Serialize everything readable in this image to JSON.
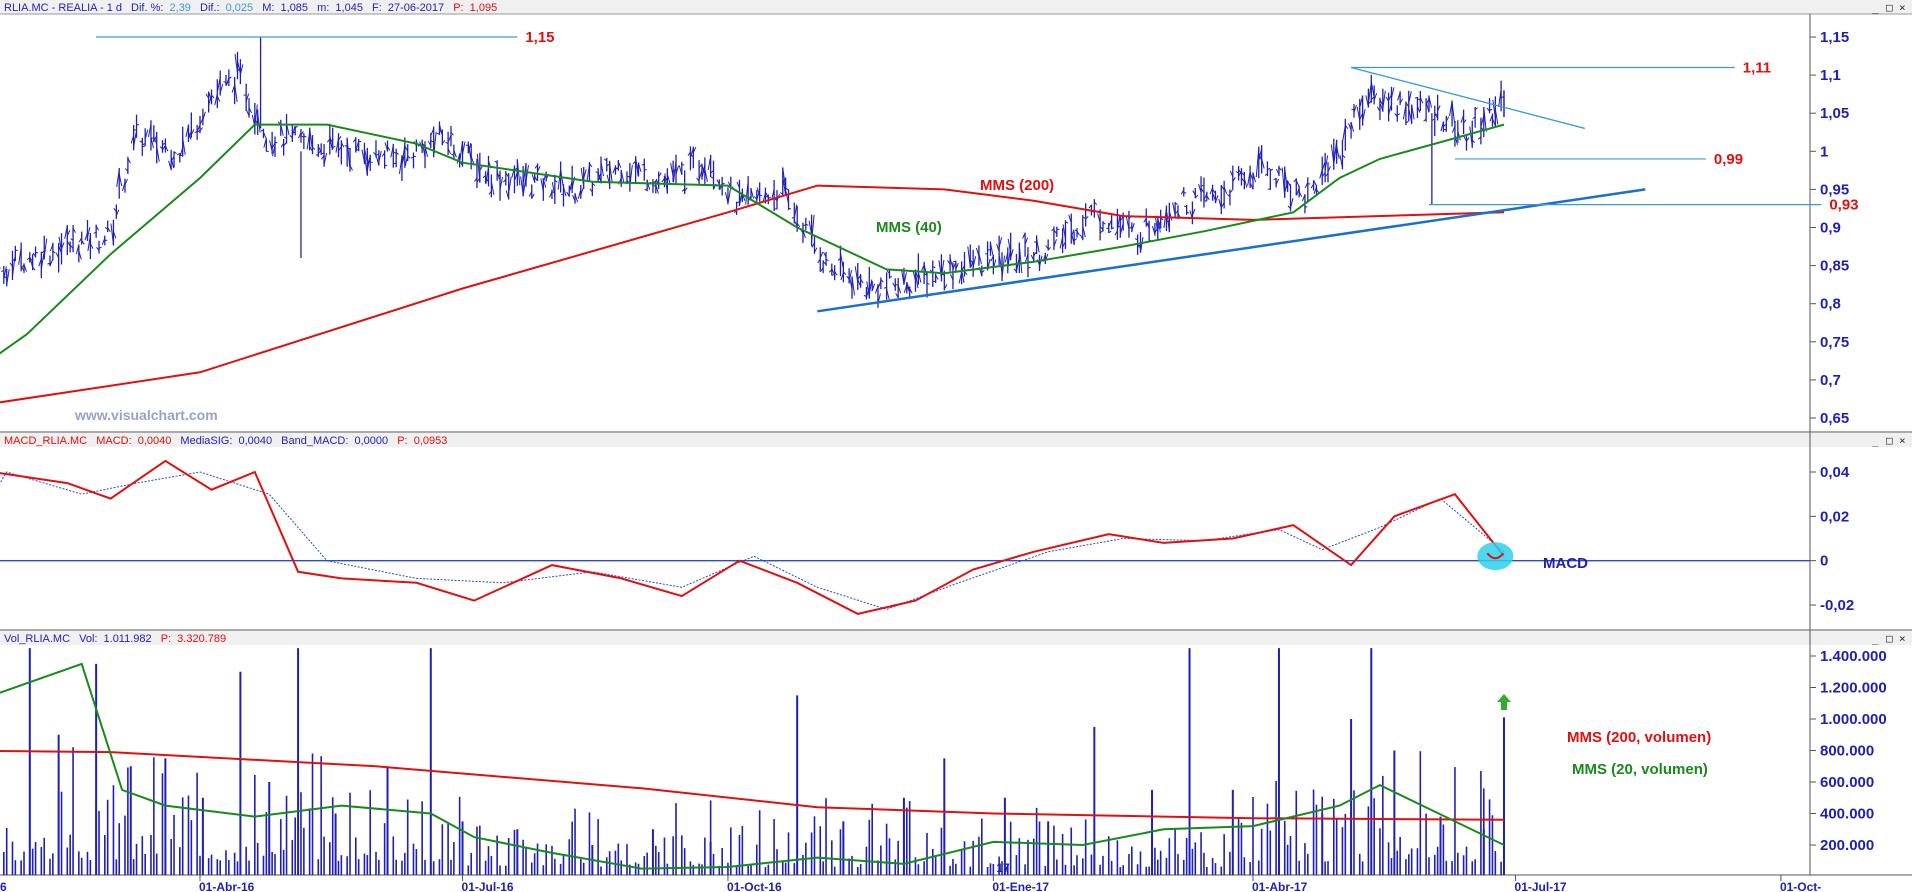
{
  "colors": {
    "price": "#1f1fb8",
    "mms200": "#e01010",
    "mms40": "#1a8a1a",
    "trend": "#1a6fd0",
    "level": "#3a9ad9",
    "macd": "#e01010",
    "signal": "#2a4ad0",
    "highlight": "#2fd0ea",
    "arrow": "#33aa33"
  },
  "window_controls": {
    "minimize": "_",
    "maximize": "□",
    "close": "×"
  },
  "price_panel": {
    "header": {
      "symbol": "RLIA.MC - REALIA - 1 d",
      "difpct_label": "Dif. %:",
      "difpct_value": "2,39",
      "dif_label": "Dif.:",
      "dif_value": "0,025",
      "m_label": "M:",
      "m_value": "1,085",
      "min_label": "m:",
      "min_value": "1,045",
      "date_label": "F:",
      "date_value": "27-06-2017",
      "p_label": "P:",
      "p_value": "1,095"
    },
    "watermark": "www.visualchart.com",
    "y_ticks": [
      "1,15",
      "1,1",
      "1,05",
      "1",
      "0,95",
      "0,9",
      "0,85",
      "0,8",
      "0,75",
      "0,7",
      "0,65"
    ],
    "labels": {
      "high1": "1,15",
      "high2": "1,11",
      "support1": "0,99",
      "support2": "0,93",
      "mms200": "MMS (200)",
      "mms40": "MMS (40)"
    }
  },
  "macd_panel": {
    "header": {
      "name": "MACD_RLIA.MC",
      "macd_label": "MACD:",
      "macd_value": "0,0040",
      "sig_label": "MediaSIG:",
      "sig_value": "0,0040",
      "band_label": "Band_MACD:",
      "band_value": "0,0000",
      "p_label": "P:",
      "p_value": "0,0953"
    },
    "y_ticks": [
      "0,04",
      "0,02",
      "0",
      "-0,02"
    ],
    "label": "MACD"
  },
  "volume_panel": {
    "header": {
      "name": "Vol_RLIA.MC",
      "vol_label": "Vol:",
      "vol_value": "1.011.982",
      "p_label": "P:",
      "p_value": "3.320.789"
    },
    "y_ticks": [
      "1.400.000",
      "1.200.000",
      "1.000.000",
      "800.000",
      "600.000",
      "400.000",
      "200.000"
    ],
    "label_mms200": "MMS (200, volumen)",
    "label_mms20": "MMS (20, volumen)"
  },
  "x_axis": {
    "ticks": [
      "01-Abr-16",
      "01-Jul-16",
      "01-Oct-16",
      "01-Ene-17",
      "01-Abr-17",
      "01-Jul-17",
      "01-Oct-"
    ],
    "left_edge": "6",
    "under_cursor": "17"
  },
  "chart_data": [
    {
      "type": "line",
      "panel": "price",
      "ylim": [
        0.64,
        1.17
      ],
      "x_start": "2016-01-04",
      "last_date": "2017-06-27",
      "high_levels": [
        1.15,
        1.11
      ],
      "support_levels": [
        0.99,
        0.93
      ],
      "series": [
        {
          "name": "MMS (200)",
          "x": [
            "2016-01-04",
            "2016-04-01",
            "2016-07-01",
            "2016-10-01",
            "2016-11-01",
            "2016-12-15",
            "2017-01-15",
            "2017-02-15",
            "2017-04-01",
            "2017-06-27"
          ],
          "values": [
            0.66,
            0.71,
            0.82,
            0.92,
            0.955,
            0.95,
            0.935,
            0.915,
            0.91,
            0.92
          ]
        },
        {
          "name": "MMS (40)",
          "x": [
            "2016-01-04",
            "2016-02-01",
            "2016-03-01",
            "2016-04-01",
            "2016-04-20",
            "2016-05-15",
            "2016-06-15",
            "2016-07-01",
            "2016-08-15",
            "2016-10-01",
            "2016-10-25",
            "2016-11-25",
            "2016-12-15",
            "2017-01-15",
            "2017-02-15",
            "2017-03-15",
            "2017-04-15",
            "2017-05-01",
            "2017-05-15",
            "2017-06-27"
          ],
          "values": [
            0.685,
            0.76,
            0.865,
            0.965,
            1.035,
            1.035,
            1.01,
            0.985,
            0.96,
            0.955,
            0.9,
            0.845,
            0.84,
            0.855,
            0.875,
            0.895,
            0.92,
            0.965,
            0.99,
            1.035
          ]
        },
        {
          "name": "Precio",
          "x": [
            "2016-01-04",
            "2016-01-15",
            "2016-02-01",
            "2016-02-20",
            "2016-03-01",
            "2016-03-10",
            "2016-03-25",
            "2016-04-05",
            "2016-04-15",
            "2016-04-25",
            "2016-05-10",
            "2016-05-25",
            "2016-06-10",
            "2016-06-25",
            "2016-07-10",
            "2016-07-25",
            "2016-08-10",
            "2016-08-25",
            "2016-09-10",
            "2016-09-25",
            "2016-10-05",
            "2016-10-20",
            "2016-11-05",
            "2016-11-20",
            "2016-12-05",
            "2016-12-20",
            "2017-01-05",
            "2017-01-20",
            "2017-02-05",
            "2017-02-20",
            "2017-03-05",
            "2017-03-20",
            "2017-04-05",
            "2017-04-20",
            "2017-05-01",
            "2017-05-10",
            "2017-05-25",
            "2017-06-05",
            "2017-06-15",
            "2017-06-27"
          ],
          "values": [
            0.67,
            0.83,
            0.86,
            0.88,
            0.89,
            1.02,
            1.0,
            1.07,
            1.1,
            1.02,
            1.01,
            1.0,
            0.99,
            1.02,
            0.97,
            0.96,
            0.95,
            0.98,
            0.96,
            0.99,
            0.93,
            0.95,
            0.85,
            0.82,
            0.83,
            0.85,
            0.86,
            0.87,
            0.92,
            0.89,
            0.93,
            0.94,
            0.98,
            0.94,
            1.0,
            1.07,
            1.06,
            1.05,
            1.02,
            1.07
          ]
        }
      ]
    },
    {
      "type": "line",
      "panel": "macd",
      "ylim": [
        -0.03,
        0.05
      ],
      "series": [
        {
          "name": "MACD",
          "x": [
            "2016-01-04",
            "2016-01-20",
            "2016-02-15",
            "2016-03-01",
            "2016-03-20",
            "2016-04-05",
            "2016-04-20",
            "2016-05-05",
            "2016-05-20",
            "2016-06-15",
            "2016-07-05",
            "2016-08-01",
            "2016-08-25",
            "2016-09-15",
            "2016-10-05",
            "2016-10-25",
            "2016-11-15",
            "2016-12-05",
            "2016-12-25",
            "2017-01-15",
            "2017-02-10",
            "2017-03-01",
            "2017-03-25",
            "2017-04-15",
            "2017-05-05",
            "2017-05-20",
            "2017-06-10",
            "2017-06-27"
          ],
          "values": [
            -0.005,
            0.04,
            0.035,
            0.028,
            0.045,
            0.032,
            0.04,
            -0.005,
            -0.008,
            -0.01,
            -0.018,
            -0.002,
            -0.008,
            -0.016,
            0.0,
            -0.01,
            -0.024,
            -0.018,
            -0.004,
            0.004,
            0.012,
            0.008,
            0.01,
            0.016,
            -0.002,
            0.02,
            0.03,
            0.002
          ]
        },
        {
          "name": "MediaSIG",
          "x": [
            "2016-01-04",
            "2016-01-25",
            "2016-02-20",
            "2016-03-10",
            "2016-04-01",
            "2016-04-25",
            "2016-05-15",
            "2016-06-15",
            "2016-07-15",
            "2016-08-15",
            "2016-09-15",
            "2016-10-10",
            "2016-11-01",
            "2016-11-25",
            "2016-12-20",
            "2017-01-20",
            "2017-02-15",
            "2017-03-15",
            "2017-04-10",
            "2017-04-25",
            "2017-05-15",
            "2017-06-05",
            "2017-06-27"
          ],
          "values": [
            -0.005,
            0.04,
            0.03,
            0.035,
            0.04,
            0.03,
            0.0,
            -0.008,
            -0.01,
            -0.005,
            -0.012,
            0.002,
            -0.012,
            -0.022,
            -0.01,
            0.004,
            0.01,
            0.009,
            0.014,
            0.005,
            0.015,
            0.028,
            0.004
          ]
        }
      ]
    },
    {
      "type": "bar",
      "panel": "volume",
      "ylim": [
        0,
        1500000
      ],
      "bars": [
        {
          "x": "2016-01-10",
          "value": 1400000
        },
        {
          "x": "2016-01-20",
          "value": 1450000
        },
        {
          "x": "2016-02-02",
          "value": 1450000
        },
        {
          "x": "2016-02-12",
          "value": 900000
        },
        {
          "x": "2016-02-25",
          "value": 1350000
        },
        {
          "x": "2016-03-08",
          "value": 700000
        },
        {
          "x": "2016-03-20",
          "value": 750000
        },
        {
          "x": "2016-04-02",
          "value": 500000
        },
        {
          "x": "2016-04-15",
          "value": 1300000
        },
        {
          "x": "2016-04-25",
          "value": 600000
        },
        {
          "x": "2016-05-05",
          "value": 1450000
        },
        {
          "x": "2016-05-18",
          "value": 400000
        },
        {
          "x": "2016-06-05",
          "value": 700000
        },
        {
          "x": "2016-06-20",
          "value": 1450000
        },
        {
          "x": "2016-07-01",
          "value": 350000
        },
        {
          "x": "2016-07-20",
          "value": 300000
        },
        {
          "x": "2016-08-15",
          "value": 200000
        },
        {
          "x": "2016-09-05",
          "value": 300000
        },
        {
          "x": "2016-09-25",
          "value": 220000
        },
        {
          "x": "2016-10-25",
          "value": 1150000
        },
        {
          "x": "2016-11-10",
          "value": 350000
        },
        {
          "x": "2016-12-01",
          "value": 500000
        },
        {
          "x": "2016-12-15",
          "value": 750000
        },
        {
          "x": "2017-01-05",
          "value": 500000
        },
        {
          "x": "2017-01-20",
          "value": 350000
        },
        {
          "x": "2017-02-05",
          "value": 950000
        },
        {
          "x": "2017-02-25",
          "value": 550000
        },
        {
          "x": "2017-03-10",
          "value": 1450000
        },
        {
          "x": "2017-03-25",
          "value": 550000
        },
        {
          "x": "2017-04-10",
          "value": 1450000
        },
        {
          "x": "2017-04-25",
          "value": 400000
        },
        {
          "x": "2017-05-05",
          "value": 1000000
        },
        {
          "x": "2017-05-12",
          "value": 1450000
        },
        {
          "x": "2017-05-20",
          "value": 800000
        },
        {
          "x": "2017-06-05",
          "value": 380000
        },
        {
          "x": "2017-06-20",
          "value": 300000
        },
        {
          "x": "2017-06-27",
          "value": 1010000
        }
      ],
      "series": [
        {
          "name": "MMS (200, volumen)",
          "x": [
            "2016-01-04",
            "2016-03-01",
            "2016-06-01",
            "2016-09-01",
            "2016-11-01",
            "2017-01-01",
            "2017-04-01",
            "2017-06-27"
          ],
          "values": [
            800000,
            790000,
            700000,
            560000,
            440000,
            400000,
            370000,
            360000
          ]
        },
        {
          "name": "MMS (20, volumen)",
          "x": [
            "2016-01-04",
            "2016-01-20",
            "2016-02-20",
            "2016-03-05",
            "2016-03-20",
            "2016-04-20",
            "2016-05-20",
            "2016-06-20",
            "2016-07-05",
            "2016-08-01",
            "2016-09-01",
            "2016-10-01",
            "2016-11-01",
            "2016-12-01",
            "2017-01-01",
            "2017-02-01",
            "2017-03-01",
            "2017-04-01",
            "2017-05-01",
            "2017-05-15",
            "2017-06-10",
            "2017-06-27"
          ],
          "values": [
            500000,
            1150000,
            1350000,
            550000,
            450000,
            380000,
            450000,
            400000,
            250000,
            150000,
            50000,
            60000,
            120000,
            80000,
            220000,
            200000,
            300000,
            320000,
            450000,
            580000,
            350000,
            200000
          ]
        }
      ]
    }
  ]
}
